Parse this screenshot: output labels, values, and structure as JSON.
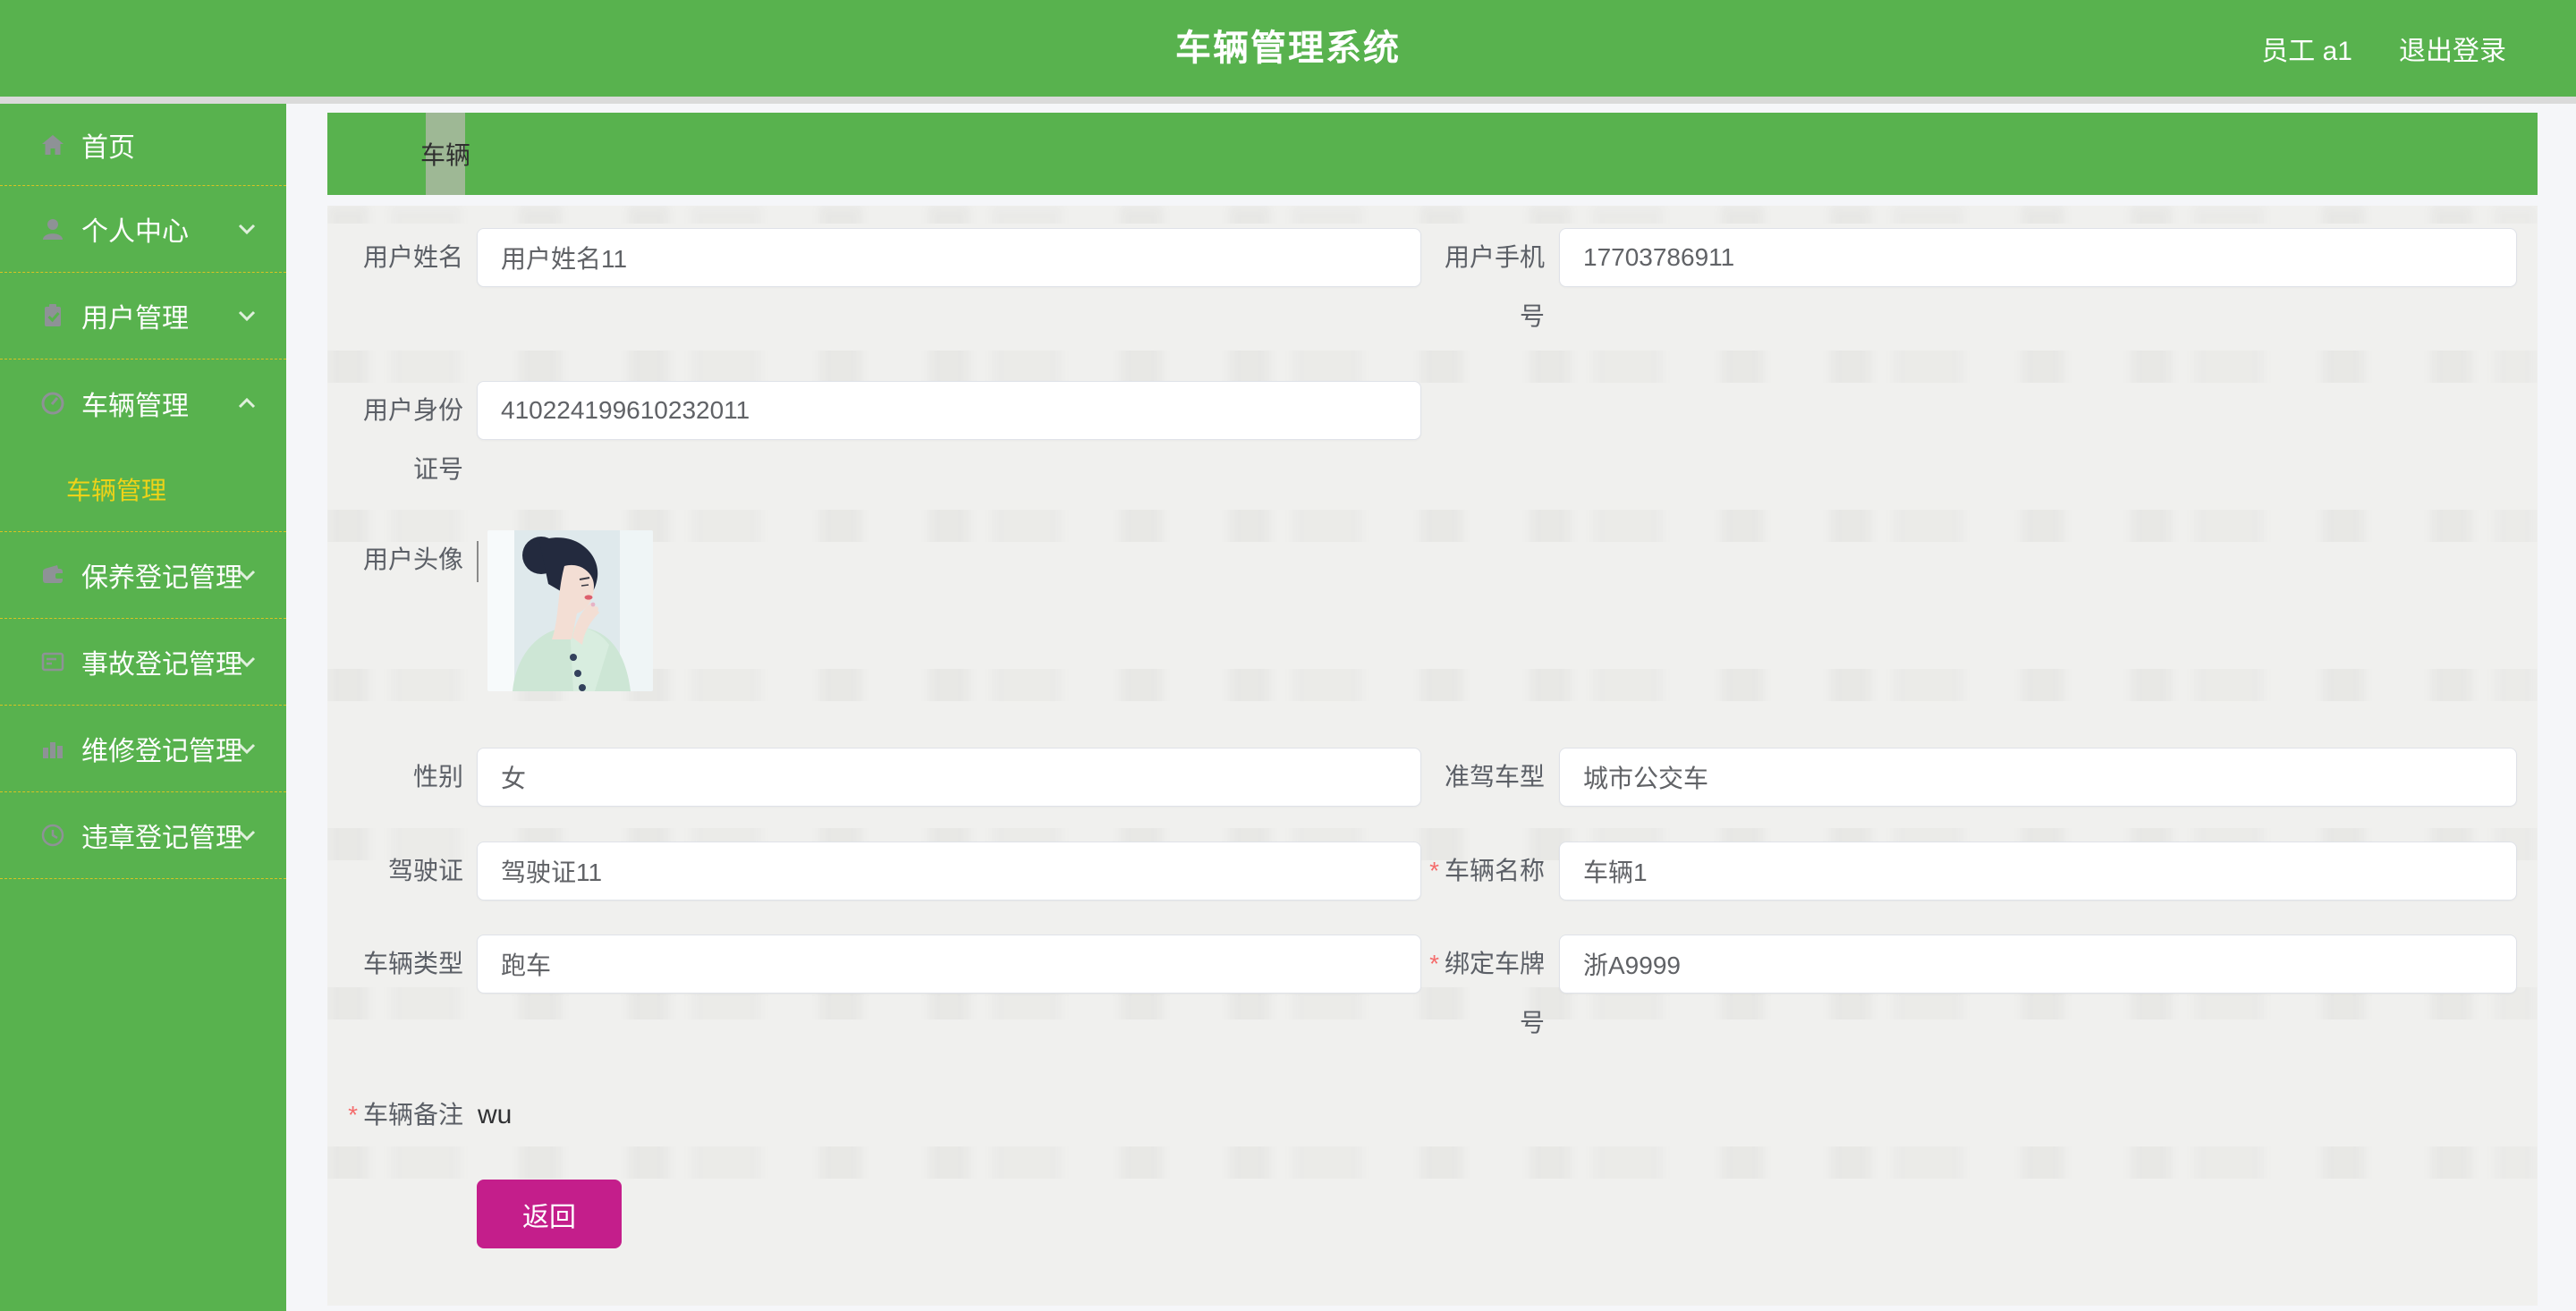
{
  "header": {
    "title": "车辆管理系统",
    "user_label": "员工 a1",
    "logout_label": "退出登录"
  },
  "sidebar": {
    "items": [
      {
        "label": "首页",
        "icon": "home-icon"
      },
      {
        "label": "个人中心",
        "icon": "user-icon",
        "chevron": "down"
      },
      {
        "label": "用户管理",
        "icon": "clipboard-icon",
        "chevron": "down"
      },
      {
        "label": "车辆管理",
        "icon": "gauge-icon",
        "chevron": "up",
        "submenu": [
          {
            "label": "车辆管理",
            "active": true
          }
        ]
      },
      {
        "label": "保养登记管理",
        "icon": "wallet-icon",
        "chevron": "down"
      },
      {
        "label": "事故登记管理",
        "icon": "document-icon",
        "chevron": "down"
      },
      {
        "label": "维修登记管理",
        "icon": "bar-chart-icon",
        "chevron": "down"
      },
      {
        "label": "违章登记管理",
        "icon": "clock-icon",
        "chevron": "down"
      }
    ]
  },
  "content": {
    "tab": {
      "label": "车辆"
    },
    "form": {
      "required_marker": "*",
      "user_name": {
        "label": "用户姓名",
        "value": "用户姓名11"
      },
      "user_phone": {
        "label": "用户手机号",
        "value": "17703786911"
      },
      "user_id": {
        "label": "用户身份证号",
        "value": "410224199610232011"
      },
      "avatar": {
        "label": "用户头像",
        "image": "woman-profile-photo"
      },
      "gender": {
        "label": "性别",
        "value": "女"
      },
      "license_type": {
        "label": "准驾车型",
        "value": "城市公交车"
      },
      "drivers_license": {
        "label": "驾驶证",
        "value": "驾驶证11"
      },
      "vehicle_name": {
        "label": "车辆名称",
        "value": "车辆1",
        "required": true
      },
      "vehicle_type": {
        "label": "车辆类型",
        "value": "跑车"
      },
      "plate_number": {
        "label": "绑定车牌号",
        "value": "浙A9999",
        "required": true
      },
      "remark": {
        "label": "车辆备注",
        "value": "wu",
        "required": true
      },
      "back_button": "返回"
    }
  },
  "colors": {
    "brand_green": "#58B24E",
    "accent_magenta": "#C41E8B",
    "active_menu_yellow": "#EFD318",
    "separator_yellow": "#D8C322",
    "required_red": "#F56C6C"
  }
}
